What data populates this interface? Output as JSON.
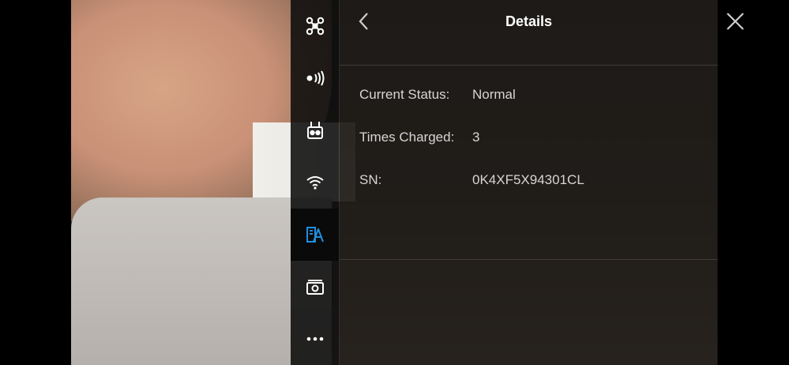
{
  "header": {
    "title": "Details"
  },
  "details": [
    {
      "label": "Current Status:",
      "value": "Normal"
    },
    {
      "label": "Times Charged:",
      "value": "3"
    },
    {
      "label": "SN:",
      "value": "0K4XF5X94301CL"
    }
  ],
  "toolbar": {
    "items": [
      {
        "icon": "drone-icon",
        "active": false
      },
      {
        "icon": "signal-icon",
        "active": false
      },
      {
        "icon": "remote-controller-icon",
        "active": false
      },
      {
        "icon": "wifi-icon",
        "active": false
      },
      {
        "icon": "battery-details-icon",
        "active": true
      },
      {
        "icon": "camera-icon",
        "active": false
      },
      {
        "icon": "more-icon",
        "active": false
      }
    ]
  },
  "colors": {
    "accent": "#1e8fe0",
    "panel_text": "#d6d6d6",
    "title_text": "#ffffff"
  }
}
